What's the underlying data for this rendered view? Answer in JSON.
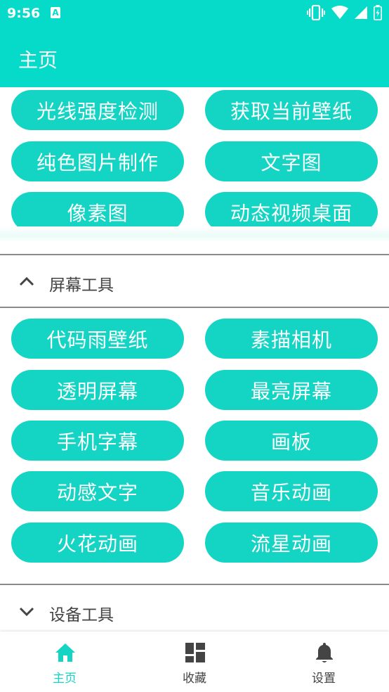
{
  "status_bar": {
    "time": "9:56",
    "a_badge": "A"
  },
  "app_bar": {
    "title": "主页"
  },
  "top_buttons": [
    {
      "label": "光线强度检测"
    },
    {
      "label": "获取当前壁纸"
    },
    {
      "label": "纯色图片制作"
    },
    {
      "label": "文字图"
    },
    {
      "label": "像素图"
    },
    {
      "label": "动态视频桌面"
    }
  ],
  "sections": [
    {
      "title": "屏幕工具",
      "expanded": true,
      "buttons": [
        {
          "label": "代码雨壁纸"
        },
        {
          "label": "素描相机"
        },
        {
          "label": "透明屏幕"
        },
        {
          "label": "最亮屏幕"
        },
        {
          "label": "手机字幕"
        },
        {
          "label": "画板"
        },
        {
          "label": "动感文字"
        },
        {
          "label": "音乐动画"
        },
        {
          "label": "火花动画"
        },
        {
          "label": "流星动画"
        }
      ]
    },
    {
      "title": "设备工具",
      "expanded": false
    }
  ],
  "bottom_nav": [
    {
      "label": "主页",
      "icon": "home-icon",
      "active": true
    },
    {
      "label": "收藏",
      "icon": "dashboard-icon",
      "active": false
    },
    {
      "label": "设置",
      "icon": "bell-icon",
      "active": false
    }
  ],
  "colors": {
    "accent": "#06dbc9",
    "button": "#14d4c3",
    "divider": "#8a8a8a",
    "text": "#444444"
  }
}
